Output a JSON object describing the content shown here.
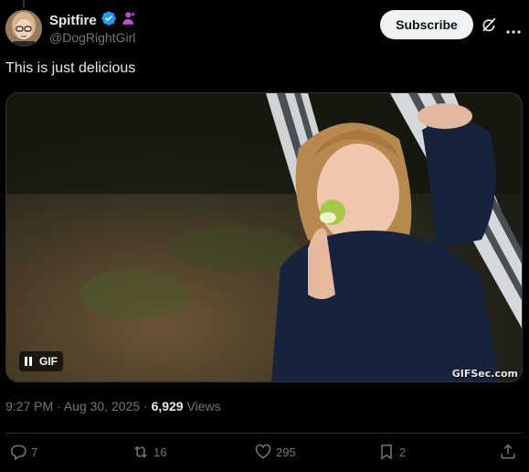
{
  "author": {
    "display_name": "Spitfire",
    "handle": "@DogRightGirl"
  },
  "header": {
    "subscribe_label": "Subscribe"
  },
  "post": {
    "text": "This is just delicious",
    "media": {
      "badge_label": "GIF",
      "watermark": "GIFSec.com"
    },
    "time": "9:27 PM",
    "date": "Aug 30, 2025",
    "views_count": "6,929",
    "views_label": "Views"
  },
  "actions": {
    "replies": "7",
    "reposts": "16",
    "likes": "295",
    "bookmarks": "2"
  },
  "colors": {
    "background": "#000000",
    "text_primary": "#e7e9ea",
    "text_secondary": "#71767b",
    "verified": "#1d9bf0",
    "affiliate_badge": "#c04cd4"
  }
}
